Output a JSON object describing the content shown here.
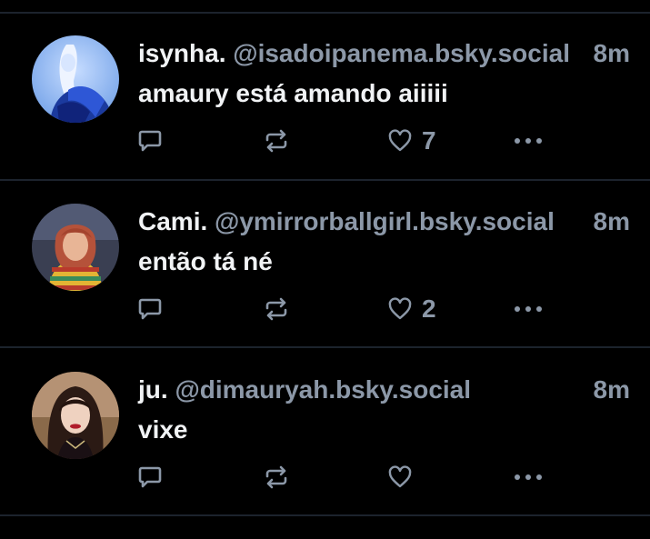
{
  "colors": {
    "background": "#000000",
    "divider": "#1c232d",
    "primary_text": "#f1f3f5",
    "secondary_text": "#8c98a8"
  },
  "posts": [
    {
      "display_name": "isynha.",
      "handle": "@isadoipanema.bsky.social",
      "time": "8m",
      "text": "amaury está amando aiiiii",
      "like_count": "7",
      "avatar": "blue-toned-portrait"
    },
    {
      "display_name": "Cami.",
      "handle": "@ymirrorballgirl.bsky.social",
      "time": "8m",
      "text": "então tá né",
      "like_count": "2",
      "avatar": "red-haired-person-striped-sweater"
    },
    {
      "display_name": "ju.",
      "handle": "@dimauryah.bsky.social",
      "time": "8m",
      "text": "vixe",
      "like_count": "",
      "avatar": "dark-haired-woman-red-lips"
    }
  ],
  "icons": {
    "reply": "speech-bubble-icon",
    "repost": "repost-arrows-icon",
    "like": "heart-icon",
    "more": "ellipsis-icon"
  }
}
